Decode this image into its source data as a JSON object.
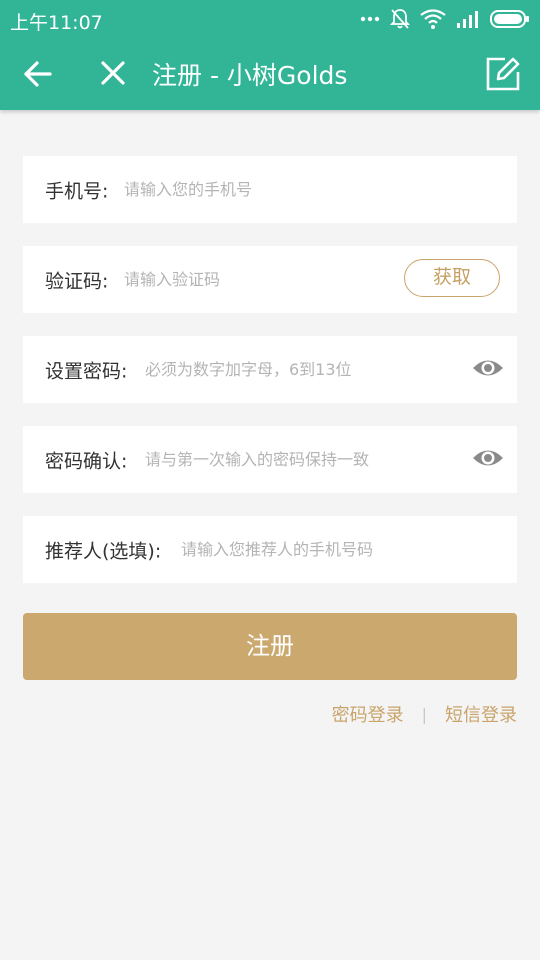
{
  "status_bar": {
    "time": "上午11:07",
    "icons": [
      "more-dots-icon",
      "bell-off-icon",
      "wifi-icon",
      "signal-icon",
      "battery-icon"
    ]
  },
  "toolbar": {
    "title": "注册 - 小树Golds",
    "back_icon": "arrow-left-icon",
    "close_icon": "close-icon",
    "edit_icon": "edit-icon"
  },
  "form": {
    "phone": {
      "label": "手机号:",
      "placeholder": "请输入您的手机号",
      "value": ""
    },
    "code": {
      "label": "验证码:",
      "placeholder": "请输入验证码",
      "value": "",
      "button": "获取"
    },
    "password": {
      "label": "设置密码:",
      "placeholder": "必须为数字加字母，6到13位",
      "value": ""
    },
    "confirm": {
      "label": "密码确认:",
      "placeholder": "请与第一次输入的密码保持一致",
      "value": ""
    },
    "referrer": {
      "label": "推荐人(选填):",
      "placeholder": "请输入您推荐人的手机号码",
      "value": ""
    }
  },
  "submit_label": "注册",
  "links": {
    "password_login": "密码登录",
    "separator": "|",
    "sms_login": "短信登录"
  },
  "colors": {
    "primary": "#31b596",
    "accent": "#caa86e",
    "background": "#f4f4f4"
  }
}
